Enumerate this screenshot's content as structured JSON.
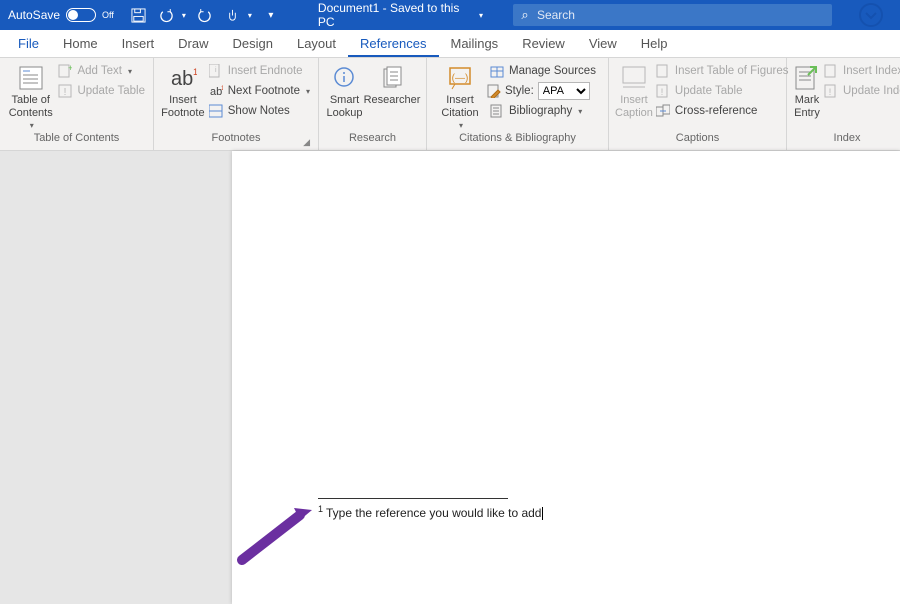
{
  "titlebar": {
    "autosave_label": "AutoSave",
    "autosave_state": "Off",
    "doc_title": "Document1  -  Saved to this PC",
    "search_placeholder": "Search"
  },
  "tabs": {
    "file": "File",
    "home": "Home",
    "insert": "Insert",
    "draw": "Draw",
    "design": "Design",
    "layout": "Layout",
    "references": "References",
    "mailings": "Mailings",
    "review": "Review",
    "view": "View",
    "help": "Help"
  },
  "ribbon": {
    "toc": {
      "table_of_contents": "Table of\nContents",
      "add_text": "Add Text",
      "update_table": "Update Table",
      "group": "Table of Contents"
    },
    "footnotes": {
      "insert_footnote": "Insert\nFootnote",
      "insert_endnote": "Insert Endnote",
      "next_footnote": "Next Footnote",
      "show_notes": "Show Notes",
      "group": "Footnotes"
    },
    "research": {
      "smart_lookup": "Smart\nLookup",
      "researcher": "Researcher",
      "group": "Research"
    },
    "citations": {
      "insert_citation": "Insert\nCitation",
      "manage_sources": "Manage Sources",
      "style_label": "Style:",
      "style_value": "APA",
      "bibliography": "Bibliography",
      "group": "Citations & Bibliography"
    },
    "captions": {
      "insert_caption": "Insert\nCaption",
      "insert_table_of_figures": "Insert Table of Figures",
      "update_table": "Update Table",
      "cross_reference": "Cross-reference",
      "group": "Captions"
    },
    "index": {
      "mark_entry": "Mark\nEntry",
      "insert_index": "Insert Index",
      "update_index": "Update Index",
      "group": "Index"
    }
  },
  "document": {
    "footnote_number": "1",
    "footnote_text": "Type the reference you would like to add"
  }
}
